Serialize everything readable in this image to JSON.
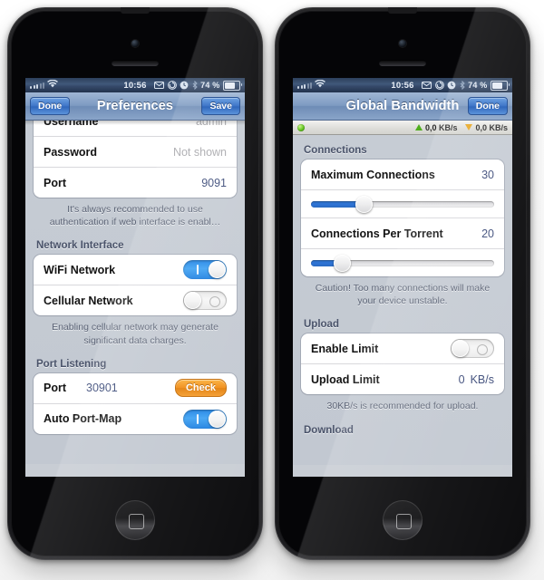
{
  "phones": {
    "left": {
      "status_bar": {
        "carrier_signal": "signal-dots",
        "wifi": "wifi-icon",
        "time": "10:56",
        "icons": [
          "mail-icon",
          "rotation-lock-icon",
          "alarm-clock-icon",
          "bluetooth-icon"
        ],
        "battery_percent": "74 %"
      },
      "nav": {
        "left_button": "Done",
        "title": "Preferences",
        "right_button": "Save"
      },
      "groups": [
        {
          "rows": [
            {
              "label": "Username",
              "value": "admin",
              "style": "placeholder"
            },
            {
              "label": "Password",
              "value": "Not shown",
              "style": "placeholder"
            },
            {
              "label": "Port",
              "value": "9091",
              "style": "value"
            }
          ],
          "footer": "It's always recommended to use authentication if web interface is enabl…"
        },
        {
          "header": "Network Interface",
          "rows": [
            {
              "label": "WiFi Network",
              "toggle": "on"
            },
            {
              "label": "Cellular Network",
              "toggle": "off"
            }
          ],
          "footer": "Enabling cellular network may generate significant data charges."
        },
        {
          "header": "Port Listening",
          "rows": [
            {
              "label": "Port",
              "value": "30901",
              "button": "Check"
            },
            {
              "label": "Auto Port-Map",
              "toggle": "on"
            }
          ]
        }
      ]
    },
    "right": {
      "status_bar": {
        "time": "10:56",
        "battery_percent": "74 %"
      },
      "nav": {
        "title": "Global Bandwidth",
        "right_button": "Done"
      },
      "speed_bar": {
        "status": "connected",
        "upload": "0,0 KB/s",
        "download": "0,0 KB/s"
      },
      "groups": [
        {
          "header": "Connections",
          "rows": [
            {
              "label": "Maximum Connections",
              "value": "30",
              "slider_percent": 29
            },
            {
              "label": "Connections Per Torrent",
              "value": "20",
              "slider_percent": 17
            }
          ],
          "footer": "Caution! Too many connections will make your device unstable."
        },
        {
          "header": "Upload",
          "rows": [
            {
              "label": "Enable Limit",
              "toggle": "off"
            },
            {
              "label": "Upload Limit",
              "value": "0",
              "unit": "KB/s"
            }
          ],
          "footer": "30KB/s is recommended for upload."
        },
        {
          "header": "Download"
        }
      ]
    }
  },
  "colors": {
    "accent_blue": "#2e74d6",
    "nav_blue": "#7e9bc2",
    "check_orange": "#f08a12",
    "toggle_on": "#1e83e6",
    "upload_green": "#4fae1e",
    "download_orange": "#e8a722",
    "value_text": "#3b4a78"
  }
}
